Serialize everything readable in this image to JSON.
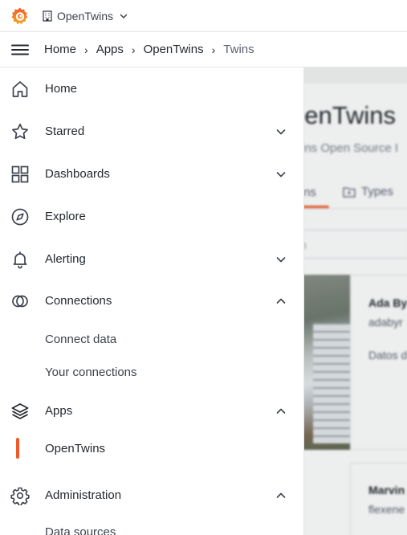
{
  "topbar": {
    "org_name": "OpenTwins",
    "logo_icon": "grafana-logo-icon",
    "org_icon": "building-icon",
    "dropdown_icon": "chevron-down-icon"
  },
  "breadcrumb": {
    "items": [
      "Home",
      "Apps",
      "OpenTwins",
      "Twins"
    ]
  },
  "menu": {
    "items": [
      {
        "label": "Home",
        "icon": "home-icon"
      },
      {
        "label": "Starred",
        "icon": "star-icon",
        "chevron": "down"
      },
      {
        "label": "Dashboards",
        "icon": "dashboards-icon",
        "chevron": "down"
      },
      {
        "label": "Explore",
        "icon": "compass-icon"
      },
      {
        "label": "Alerting",
        "icon": "bell-icon",
        "chevron": "down"
      },
      {
        "label": "Connections",
        "icon": "connections-icon",
        "chevron": "up"
      },
      {
        "label": "Apps",
        "icon": "layers-icon",
        "chevron": "up"
      },
      {
        "label": "Administration",
        "icon": "gear-icon",
        "chevron": "up"
      }
    ],
    "connections_sub": [
      "Connect data",
      "Your connections"
    ],
    "apps_sub": [
      "OpenTwins"
    ],
    "admin_sub": [
      "Data sources"
    ]
  },
  "background": {
    "title": "penTwins",
    "subtitle": "ins Open Source I",
    "tabs": [
      "ns",
      "Types"
    ],
    "search_text": "h",
    "cards": [
      {
        "name": "Ada By",
        "id": "adabyr",
        "desc": "Datos d"
      },
      {
        "name": "Marvin",
        "id": "flexene"
      }
    ]
  },
  "colors": {
    "accent": "#f05a28",
    "text": "#24292e",
    "muted": "#5a6170",
    "border": "#e4e6ea"
  }
}
